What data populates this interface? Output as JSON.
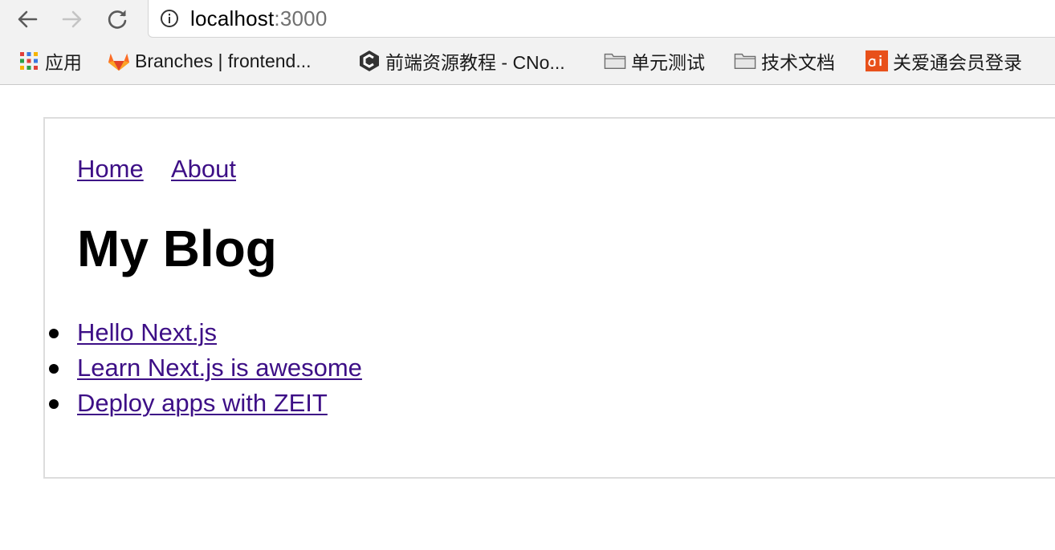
{
  "browser": {
    "url_host": "localhost",
    "url_port": ":3000",
    "bookmarks": [
      {
        "label": "应用",
        "icon": "apps-grid-icon"
      },
      {
        "label": "Branches | frontend...",
        "icon": "gitlab-icon"
      },
      {
        "label": "前端资源教程 - CNo...",
        "icon": "cnode-icon"
      },
      {
        "label": "单元测试",
        "icon": "folder-icon"
      },
      {
        "label": "技术文档",
        "icon": "folder-icon"
      },
      {
        "label": "关爱通会员登录",
        "icon": "ai-logo-icon"
      }
    ]
  },
  "page": {
    "nav": [
      {
        "label": "Home"
      },
      {
        "label": "About"
      }
    ],
    "title": "My Blog",
    "posts": [
      {
        "title": "Hello Next.js"
      },
      {
        "title": "Learn Next.js is awesome"
      },
      {
        "title": "Deploy apps with ZEIT"
      }
    ]
  },
  "colors": {
    "link": "#3d0f86",
    "chrome_bg": "#f2f2f2",
    "card_border": "#dddddd"
  }
}
